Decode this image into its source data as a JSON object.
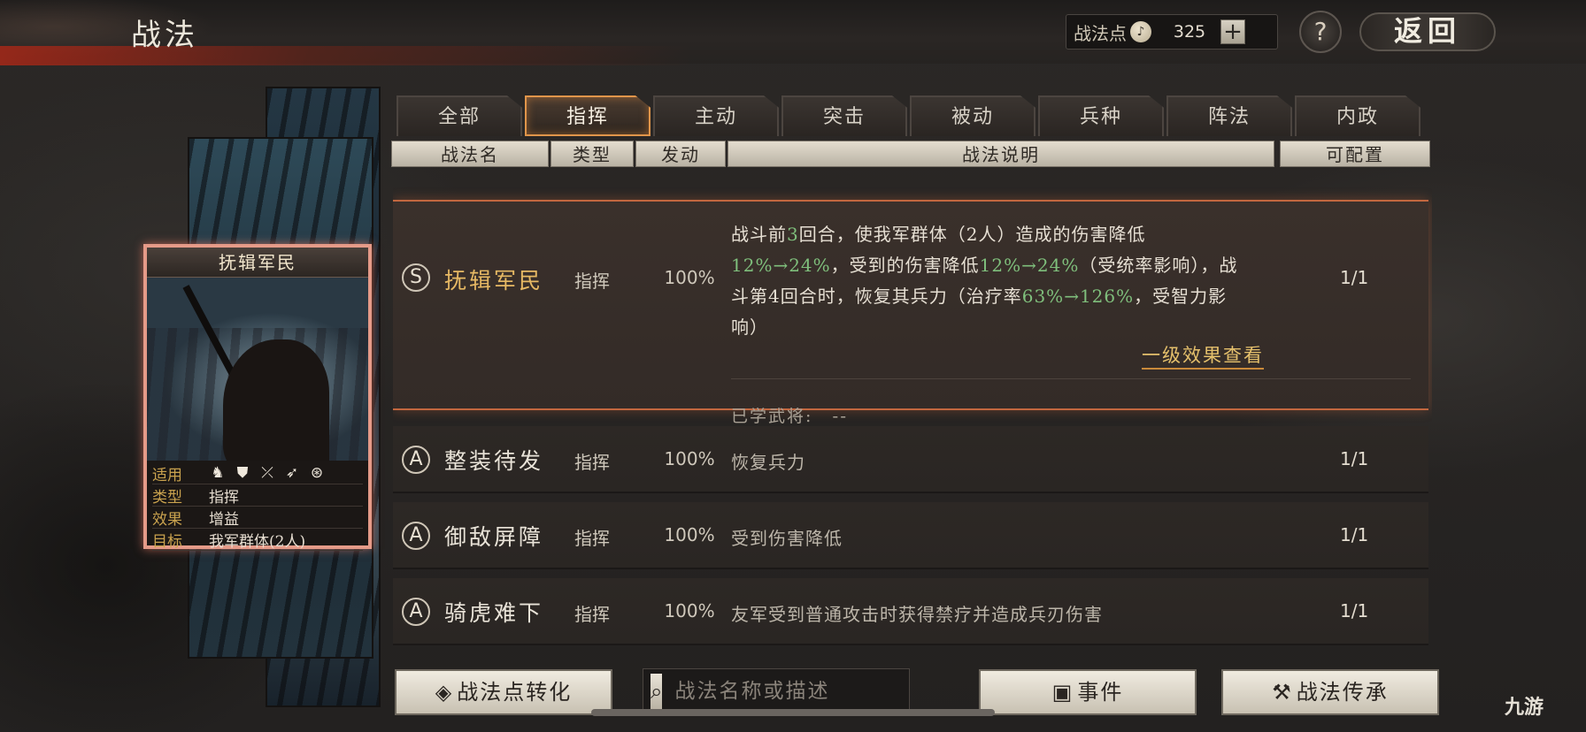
{
  "header": {
    "title": "战法",
    "points_label": "战法点",
    "points_value": "325",
    "plus": "+",
    "help": "?",
    "back": "返回"
  },
  "card": {
    "title": "抚辑军民",
    "rows": [
      {
        "key": "适用",
        "value": ""
      },
      {
        "key": "类型",
        "value": "指挥"
      },
      {
        "key": "效果",
        "value": "增益"
      },
      {
        "key": "目标",
        "value": "我军群体(2人)"
      }
    ],
    "troop_icons": [
      "cavalry-icon",
      "shield-icon",
      "bow-icon",
      "spear-icon",
      "wheel-icon"
    ]
  },
  "tabs": [
    {
      "label": "全部",
      "active": false
    },
    {
      "label": "指挥",
      "active": true
    },
    {
      "label": "主动",
      "active": false
    },
    {
      "label": "突击",
      "active": false
    },
    {
      "label": "被动",
      "active": false
    },
    {
      "label": "兵种",
      "active": false
    },
    {
      "label": "阵法",
      "active": false
    },
    {
      "label": "内政",
      "active": false
    }
  ],
  "columns": {
    "name": "战法名",
    "type": "类型",
    "rate": "发动",
    "desc": "战法说明",
    "config": "可配置"
  },
  "selected": {
    "grade": "S",
    "name": "抚辑军民",
    "type": "指挥",
    "rate": "100%",
    "config": "1/1",
    "desc_parts": [
      {
        "t": "战斗前",
        "hl": false
      },
      {
        "t": "3",
        "hl": true
      },
      {
        "t": "回合，使我军群体（2人）造成的伤害降低",
        "hl": false
      },
      {
        "t": "12%→24%",
        "hl": true
      },
      {
        "t": "，受到的伤害降低",
        "hl": false
      },
      {
        "t": "12%→24%",
        "hl": true
      },
      {
        "t": "（受统率影响），战斗第4回合时，恢复其兵力（治疗率",
        "hl": false
      },
      {
        "t": "63%→126%",
        "hl": true
      },
      {
        "t": "，受智力影响）",
        "hl": false
      }
    ],
    "link": "一级效果查看",
    "learned_label": "已学武将:",
    "learned_value": "--"
  },
  "rows": [
    {
      "grade": "A",
      "name": "整装待发",
      "type": "指挥",
      "rate": "100%",
      "desc": "恢复兵力",
      "config": "1/1"
    },
    {
      "grade": "A",
      "name": "御敌屏障",
      "type": "指挥",
      "rate": "100%",
      "desc": "受到伤害降低",
      "config": "1/1"
    },
    {
      "grade": "A",
      "name": "骑虎难下",
      "type": "指挥",
      "rate": "100%",
      "desc": "友军受到普通攻击时获得禁疗并造成兵刃伤害",
      "config": "1/1"
    }
  ],
  "footer": {
    "convert_label": "战法点转化",
    "search_placeholder": "战法名称或描述",
    "events_label": "事件",
    "inherit_label": "战法传承"
  },
  "watermark": "九游",
  "colors": {
    "accent_orange": "#e0954a",
    "highlight_green": "#7fbf7c",
    "gold_text": "#e7b964",
    "card_border": "#e59a88"
  }
}
